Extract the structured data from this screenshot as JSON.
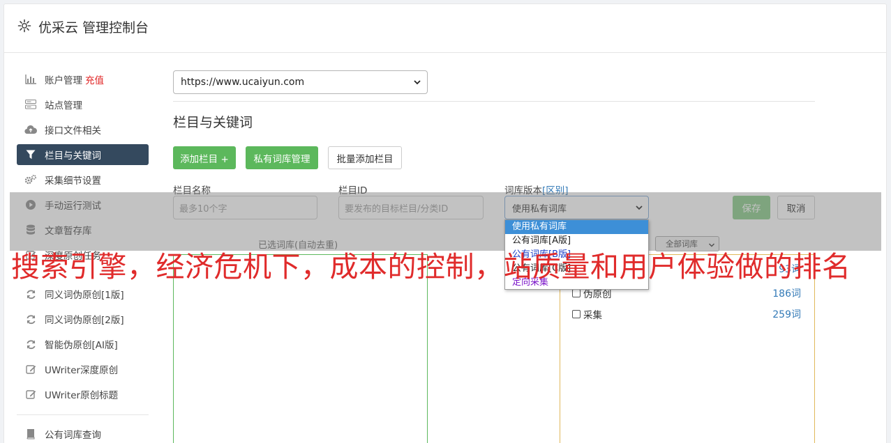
{
  "header": {
    "title": "优采云 管理控制台"
  },
  "sidebar": {
    "items": [
      {
        "label": "账户管理",
        "extra": "充值"
      },
      {
        "label": "站点管理"
      },
      {
        "label": "接口文件相关"
      },
      {
        "label": "栏目与关键词"
      },
      {
        "label": "采集细节设置"
      },
      {
        "label": "手动运行测试"
      },
      {
        "label": "文章暂存库"
      },
      {
        "label": "深度原创任务"
      },
      {
        "label": "同义词伪原创[1版]"
      },
      {
        "label": "同义词伪原创[2版]"
      },
      {
        "label": "智能伪原创[AI版]"
      },
      {
        "label": "UWriter深度原创"
      },
      {
        "label": "UWriter原创标题"
      },
      {
        "label": "公有词库查询"
      }
    ]
  },
  "site_select": {
    "value": "https://www.ucaiyun.com"
  },
  "section": {
    "title": "栏目与关键词"
  },
  "buttons": {
    "add_column": "添加栏目 +",
    "private_lib": "私有词库管理",
    "batch_add": "批量添加栏目",
    "save": "保存",
    "cancel": "取消"
  },
  "form": {
    "name_label": "栏目名称",
    "name_placeholder": "最多10个字",
    "id_label": "栏目ID",
    "id_placeholder": "要发布的目标栏目/分类ID",
    "version_label": "词库版本",
    "version_link": "[区别]",
    "version_value": "使用私有词库"
  },
  "dropdown": {
    "options": [
      "使用私有词库",
      "公有词库[A版]",
      "公有词库[B版]",
      "公有词库[C版]",
      "定向采集"
    ]
  },
  "boxes": {
    "selected_label": "已选词库(自动去重)",
    "filter_value": "全部词库",
    "libs": [
      {
        "name": "",
        "count": "93词"
      },
      {
        "name": "伪原创",
        "count": "186词"
      },
      {
        "name": "采集",
        "count": "259词"
      }
    ]
  },
  "watermark": {
    "text": "搜索引擎，经济危机下，成本的控制，站质量和用户体验做的排名"
  }
}
